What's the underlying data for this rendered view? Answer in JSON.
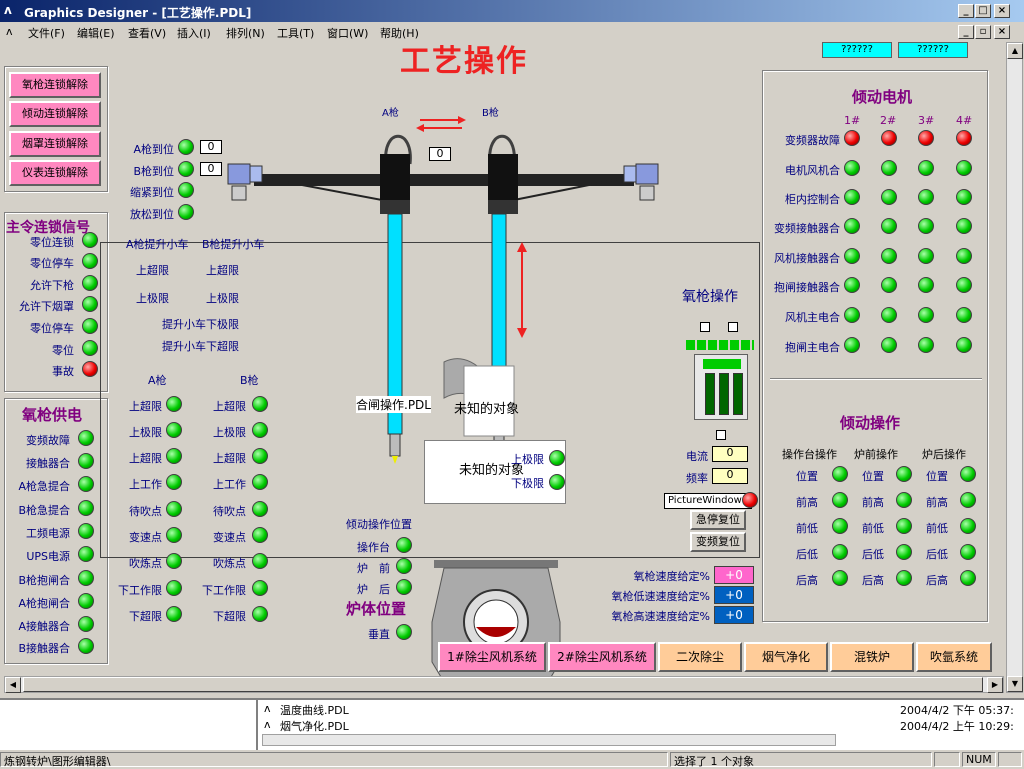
{
  "window": {
    "title": "Graphics Designer - [工艺操作.PDL]"
  },
  "menu": [
    "文件(F)",
    "编辑(E)",
    "查看(V)",
    "插入(I)",
    "排列(N)",
    "工具(T)",
    "窗口(W)",
    "帮助(H)"
  ],
  "page_title": "工艺操作",
  "top_buttons": [
    "??????",
    "??????"
  ],
  "unlock_buttons": [
    "氧枪连锁解除",
    "倾动连锁解除",
    "烟罩连锁解除",
    "仪表连锁解除"
  ],
  "master_signal": {
    "title": "主令连锁信号",
    "items": [
      "零位连锁",
      "零位停车",
      "允许下枪",
      "允许下烟罩",
      "零位停车",
      "零位",
      "事故"
    ]
  },
  "lance_supply": {
    "title": "氧枪供电",
    "items": [
      "变频故障",
      "接触器合",
      "A枪急提合",
      "B枪急提合",
      "工频电源",
      "UPS电源",
      "B枪抱闸合",
      "A枪抱闸合",
      "A接触器合",
      "B接触器合"
    ]
  },
  "position": {
    "items": [
      "A枪到位",
      "B枪到位",
      "缩紧到位",
      "放松到位"
    ],
    "values": [
      "0",
      "0"
    ],
    "center_value": "0"
  },
  "gun_labels": {
    "a": "A枪",
    "b": "B枪"
  },
  "trolley": {
    "a_title": "A枪提升小车",
    "b_title": "B枪提升小车",
    "a_upper": "上超限",
    "b_upper": "上超限",
    "a_lower": "上极限",
    "b_lower": "上极限",
    "lower_limit": "提升小车下极限",
    "upper_limit": "提升小车下超限"
  },
  "gun_status": {
    "a_title": "A枪",
    "b_title": "B枪",
    "items": [
      "上超限",
      "上极限",
      "上超限",
      "上工作",
      "待吹点",
      "变速点",
      "吹炼点",
      "下工作限",
      "下超限"
    ],
    "items_b": [
      "上超限",
      "上极限",
      "上超限",
      "上工作",
      "待吹点",
      "变速点",
      "吹炼点",
      "下工作限",
      "下超限"
    ]
  },
  "tilt_position": {
    "title": "倾动操作位置",
    "items": [
      "操作台",
      "炉　前",
      "炉　后"
    ]
  },
  "furnace": {
    "title": "炉体位置",
    "vertical": "垂直"
  },
  "overlays": {
    "pdl": "合闸操作.PDL",
    "unknown1": "未知的对象",
    "unknown2": "未知的对象",
    "upper_limit": "上极限",
    "lower_limit": "下极限"
  },
  "lance_op": {
    "title": "氧枪操作",
    "current": "电流",
    "frequency": "频率",
    "current_val": "0",
    "freq_val": "0",
    "tooltip": "PictureWindow1",
    "btn_stop": "急停复位",
    "btn_vfd": "变频复位"
  },
  "speed": {
    "items": [
      "氧枪速度给定%",
      "氧枪低速速度给定%",
      "氧枪高速速度给定%"
    ],
    "values": [
      "+0",
      "+0",
      "+0"
    ]
  },
  "tilt_motor": {
    "title": "倾动电机",
    "cols": [
      "1#",
      "2#",
      "3#",
      "4#"
    ],
    "rows": [
      "变频器故障",
      "电机风机合",
      "柜内控制合",
      "变频接触器合",
      "风机接触器合",
      "抱闸接触器合",
      "风机主电合",
      "抱闸主电合"
    ]
  },
  "tilt_op": {
    "title": "倾动操作",
    "cols": [
      "操作台操作",
      "炉前操作",
      "炉后操作"
    ],
    "rows": [
      "位置",
      "前高",
      "前低",
      "后低",
      "后高"
    ]
  },
  "bottom_buttons": [
    "1#除尘风机系统",
    "2#除尘风机系统",
    "二次除尘",
    "烟气净化",
    "混铁炉",
    "吹氩系统"
  ],
  "output": [
    {
      "name": "温度曲线.PDL",
      "time": "2004/4/2 下午 05:37:"
    },
    {
      "name": "烟气净化.PDL",
      "time": "2004/4/2 上午 10:29:"
    }
  ],
  "status": {
    "left": "炼钢转炉\\图形编辑器\\",
    "middle": "选择了 1 个对象",
    "num": "NUM"
  },
  "colors": {
    "accent": "#800080",
    "led_on": "#00cc00",
    "led_alarm": "#ee0000",
    "pink": "#ff88c0"
  }
}
